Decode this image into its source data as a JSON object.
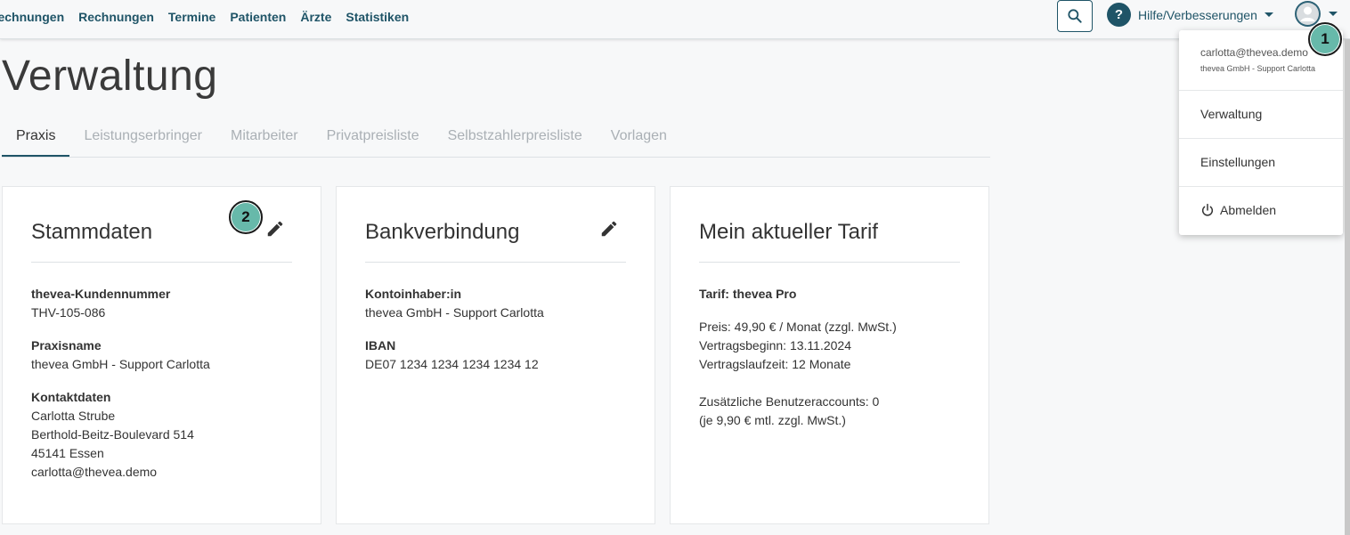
{
  "nav": {
    "items": [
      {
        "label": "rechnungen"
      },
      {
        "label": "Rechnungen"
      },
      {
        "label": "Termine"
      },
      {
        "label": "Patienten"
      },
      {
        "label": "Ärzte"
      },
      {
        "label": "Statistiken"
      }
    ],
    "help_label": "Hilfe/Verbesserungen",
    "help_glyph": "?"
  },
  "page": {
    "title": "Verwaltung"
  },
  "tabs": [
    {
      "label": "Praxis",
      "active": true
    },
    {
      "label": "Leistungserbringer"
    },
    {
      "label": "Mitarbeiter"
    },
    {
      "label": "Privatpreisliste"
    },
    {
      "label": "Selbstzahlerpreisliste"
    },
    {
      "label": "Vorlagen"
    }
  ],
  "stammdaten": {
    "title": "Stammdaten",
    "kundennummer_label": "thevea-Kundennummer",
    "kundennummer": "THV-105-086",
    "praxisname_label": "Praxisname",
    "praxisname": "thevea GmbH - Support Carlotta",
    "kontakt_label": "Kontaktdaten",
    "kontakt_name": "Carlotta Strube",
    "kontakt_strasse": "Berthold-Beitz-Boulevard 514",
    "kontakt_ort": "45141 Essen",
    "kontakt_email": "carlotta@thevea.demo"
  },
  "bank": {
    "title": "Bankverbindung",
    "inhaber_label": "Kontoinhaber:in",
    "inhaber": "thevea GmbH - Support Carlotta",
    "iban_label": "IBAN",
    "iban": "DE07 1234 1234 1234 1234 12"
  },
  "tarif": {
    "title": "Mein aktueller Tarif",
    "name": "Tarif: thevea Pro",
    "preis": "Preis: 49,90 € / Monat (zzgl. MwSt.)",
    "beginn": "Vertragsbeginn: 13.11.2024",
    "laufzeit": "Vertragslaufzeit: 12 Monate",
    "accounts": "Zusätzliche Benutzeraccounts: 0",
    "accounts_preis": "(je 9,90 € mtl. zzgl. MwSt.)"
  },
  "user_menu": {
    "email": "carlotta@thevea.demo",
    "org": "thevea GmbH - Support Carlotta",
    "items": [
      {
        "label": "Verwaltung"
      },
      {
        "label": "Einstellungen"
      },
      {
        "label": "Abmelden",
        "icon": "power-icon"
      }
    ]
  },
  "badges": [
    "1",
    "2"
  ],
  "icons": {
    "search": "search-icon",
    "edit": "pencil-icon",
    "avatar": "user-avatar-icon",
    "dropdown": "caret-down-icon"
  },
  "colors": {
    "primary": "#1f5467",
    "badge": "#67b9aa",
    "tab_inactive": "#aab0b5",
    "background": "#f7f8f9"
  }
}
